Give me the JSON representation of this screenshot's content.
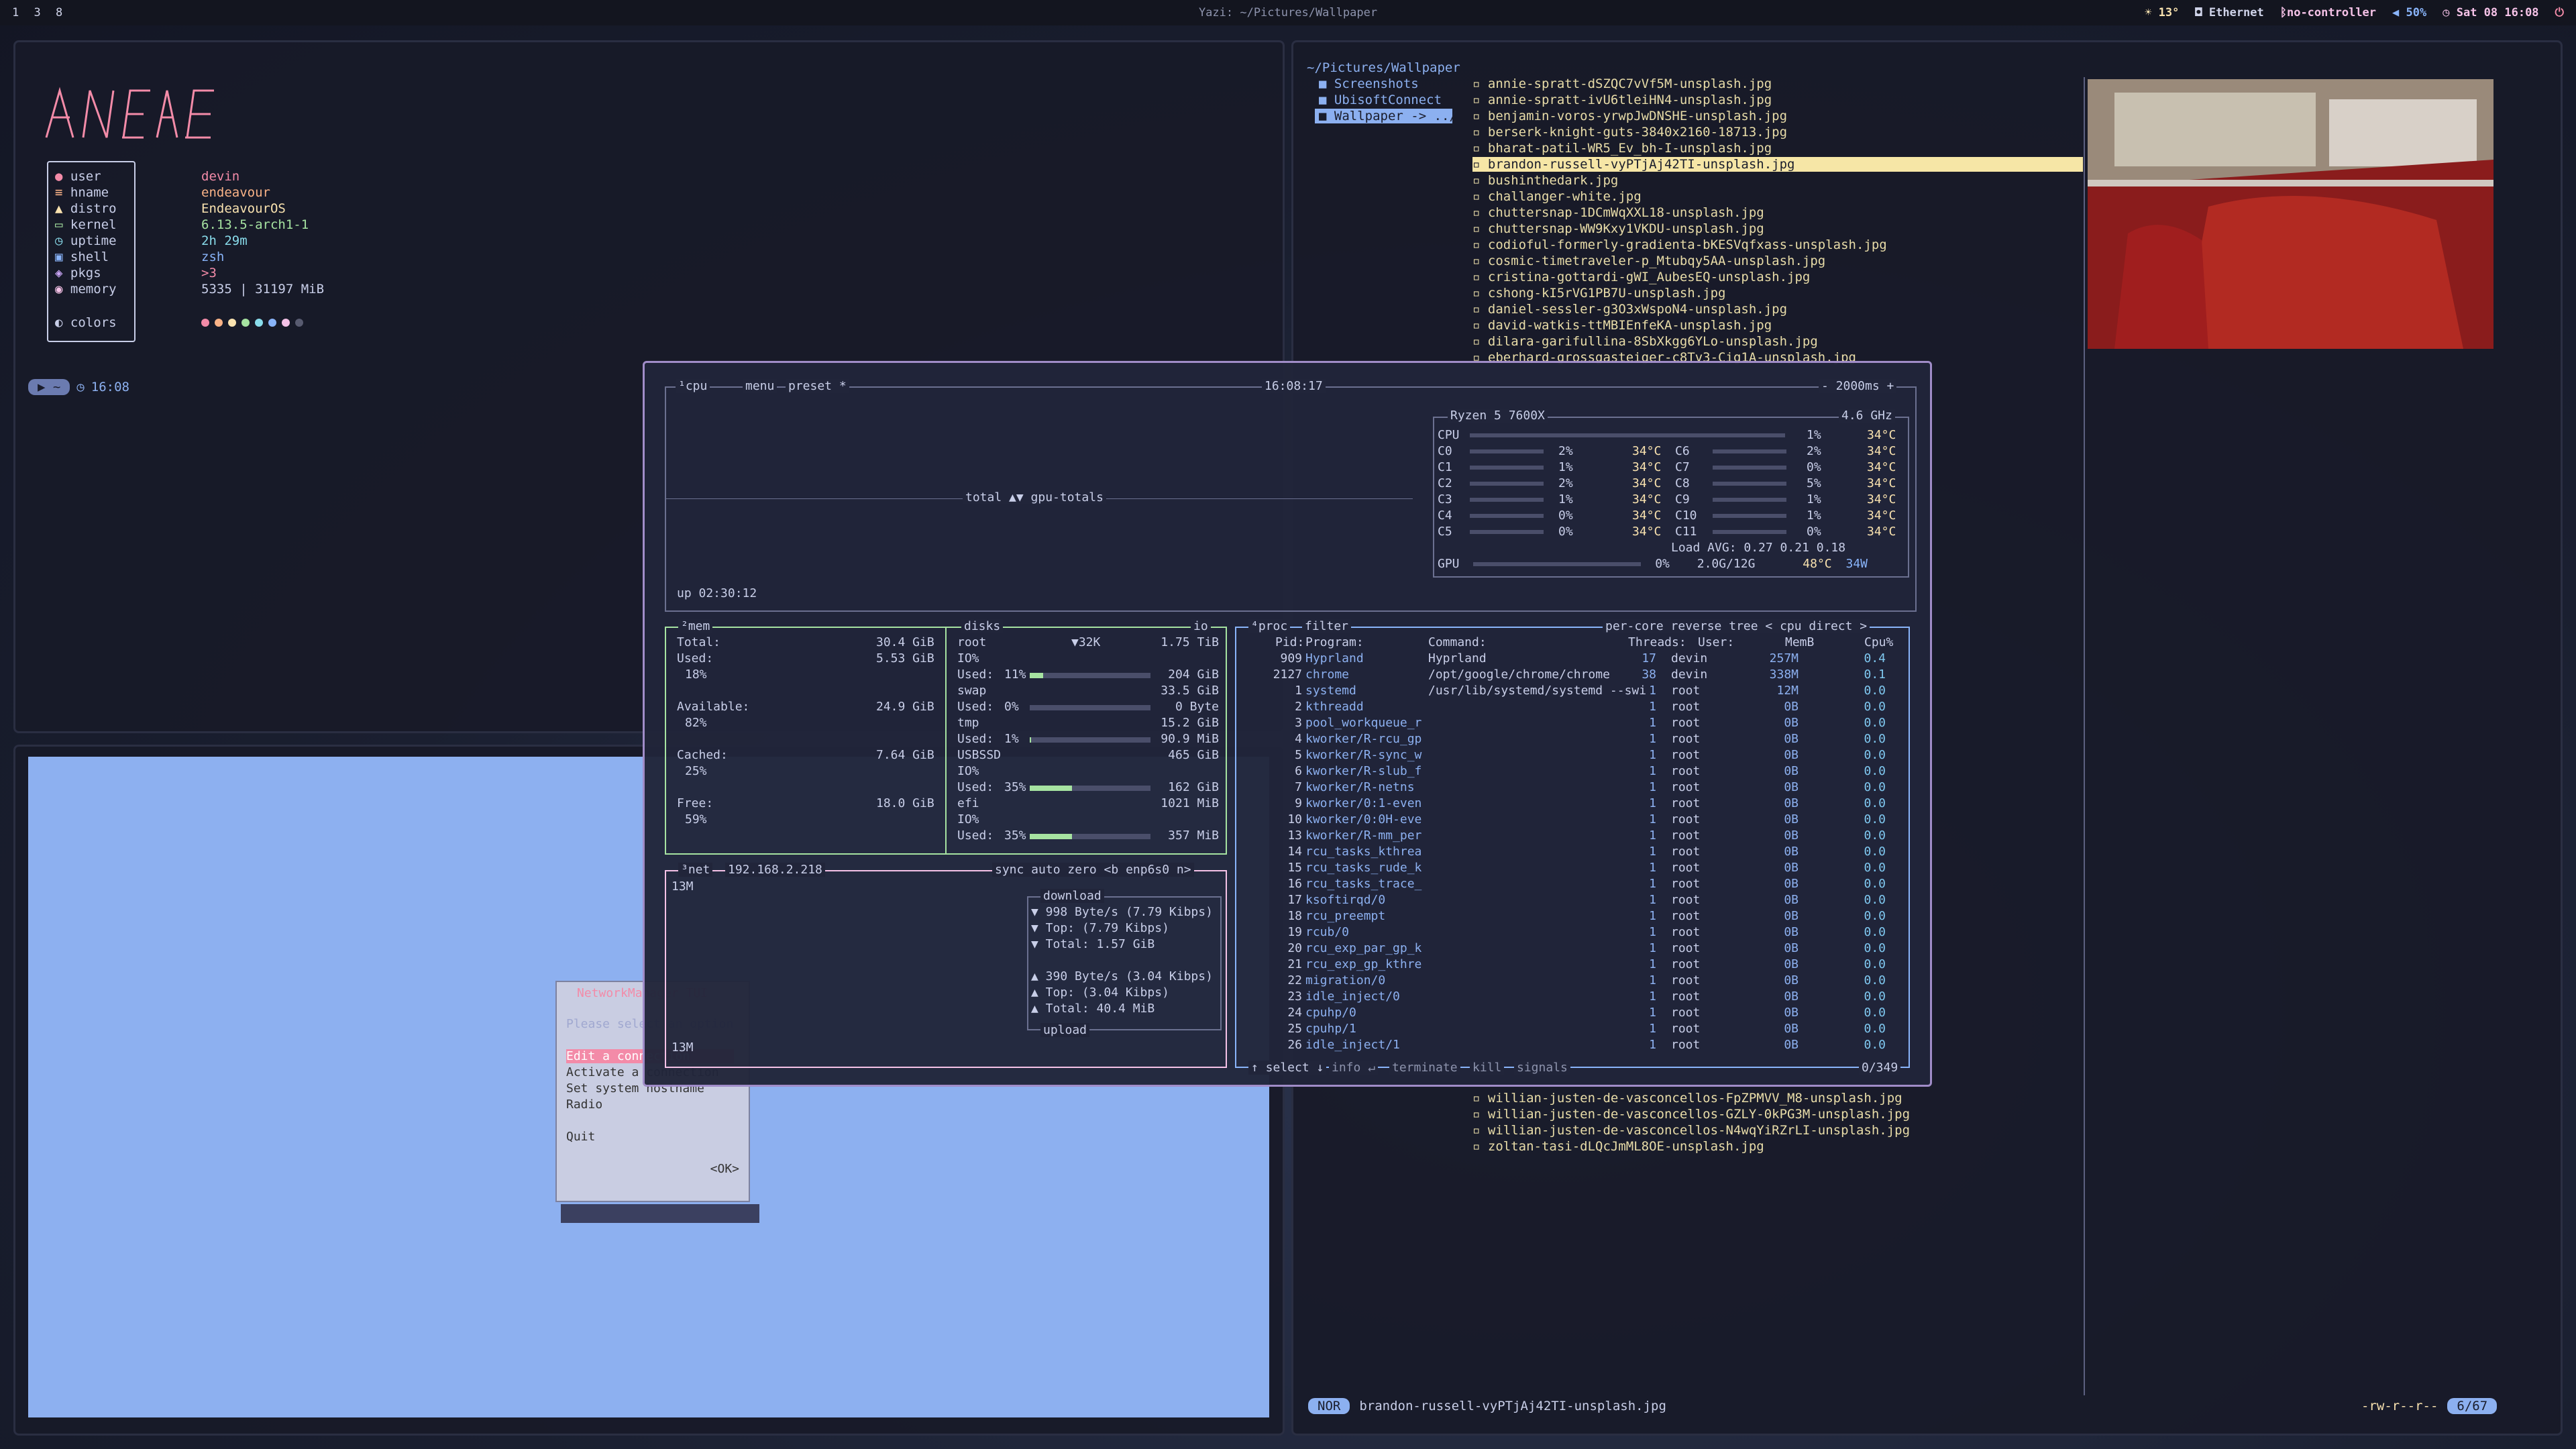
{
  "topbar": {
    "workspaces": [
      "1",
      "3",
      "8"
    ],
    "title": "Yazi: ~/Pictures/Wallpaper",
    "weather": "☀ 13°",
    "network": "Ethernet",
    "controller": "no-controller",
    "volume": "50%",
    "datetime": "Sat 08 16:08"
  },
  "fetch": {
    "rows": [
      {
        "key": "user",
        "val": "devin"
      },
      {
        "key": "hname",
        "val": "endeavour"
      },
      {
        "key": "distro",
        "val": "EndeavourOS"
      },
      {
        "key": "kernel",
        "val": "6.13.5-arch1-1"
      },
      {
        "key": "uptime",
        "val": "2h 29m"
      },
      {
        "key": "shell",
        "val": "zsh"
      },
      {
        "key": "pkgs",
        "val": ">3"
      },
      {
        "key": "memory",
        "val": "5335 | 31197 MiB"
      }
    ],
    "colors_label": "colors",
    "dot_colors": [
      "#f38ba8",
      "#fab387",
      "#f9e2af",
      "#a6e3a1",
      "#89dceb",
      "#89b4fa",
      "#f5c2e7",
      "#585b70"
    ]
  },
  "prompt": {
    "path": "~",
    "time": "16:08"
  },
  "nmtui": {
    "title": "NetworkManager TUI",
    "hint": "Please select an option",
    "items": [
      "Edit a connection",
      "Activate a connection",
      "Set system hostname",
      "Radio",
      "Quit"
    ],
    "ok": "<OK>"
  },
  "yazi": {
    "path": "~/Pictures/Wallpaper",
    "dirs": [
      "Screenshots",
      "UbisoftConnect",
      "Wallpaper -> ../"
    ],
    "files_top": [
      "annie-spratt-dSZQC7vVf5M-unsplash.jpg",
      "annie-spratt-ivU6tleiHN4-unsplash.jpg",
      "benjamin-voros-yrwpJwDNSHE-unsplash.jpg",
      "berserk-knight-guts-3840x2160-18713.jpg",
      "bharat-patil-WR5_Ev_bh-I-unsplash.jpg",
      "brandon-russell-vyPTjAj42TI-unsplash.jpg",
      "bushinthedark.jpg",
      "challanger-white.jpg",
      "chuttersnap-1DCmWqXXL18-unsplash.jpg",
      "chuttersnap-WW9Kxy1VKDU-unsplash.jpg",
      "codioful-formerly-gradienta-bKESVqfxass-unsplash.jpg",
      "cosmic-timetraveler-p_Mtubqy5AA-unsplash.jpg",
      "cristina-gottardi-gWI_AubesEQ-unsplash.jpg",
      "cshong-kI5rVG1PB7U-unsplash.jpg",
      "daniel-sessler-g3O3xWspoN4-unsplash.jpg",
      "david-watkis-ttMBIEnfeKA-unsplash.jpg",
      "dilara-garifullina-8SbXkgg6YLo-unsplash.jpg",
      "eberhard-grossgasteiger-c8Tv3-Cig1A-unsplash.jpg"
    ],
    "files_bottom": [
      "willian-justen-de-vasconcellos-FpZPMVV_M8-unsplash.jpg",
      "willian-justen-de-vasconcellos-GZLY-0kPG3M-unsplash.jpg",
      "willian-justen-de-vasconcellos-N4wqYiRZrLI-unsplash.jpg",
      "zoltan-tasi-dLQcJmML8OE-unsplash.jpg"
    ],
    "selected_index": 5,
    "status_mode": "NOR",
    "status_file": "brandon-russell-vyPTjAj42TI-unsplash.jpg",
    "status_perm": "-rw-r--r--",
    "status_pos": "6/67"
  },
  "btop": {
    "cpu_tab": "¹cpu",
    "menu": "menu",
    "preset": "preset *",
    "clock": "16:08:17",
    "interval": "- 2000ms +",
    "graph_label": "total ▲▼ gpu-totals",
    "uptime": "up 02:30:12",
    "cpu_model": "Ryzen 5 7600X",
    "cpu_freq": "4.6 GHz",
    "cpu_total": {
      "name": "CPU",
      "pct": "1%",
      "temp": "34°C"
    },
    "cores": [
      {
        "a": "C0",
        "ap": "2%",
        "at": "34°C",
        "b": "C6",
        "bp": "2%",
        "bt": "34°C"
      },
      {
        "a": "C1",
        "ap": "1%",
        "at": "34°C",
        "b": "C7",
        "bp": "0%",
        "bt": "34°C"
      },
      {
        "a": "C2",
        "ap": "2%",
        "at": "34°C",
        "b": "C8",
        "bp": "5%",
        "bt": "34°C"
      },
      {
        "a": "C3",
        "ap": "1%",
        "at": "34°C",
        "b": "C9",
        "bp": "1%",
        "bt": "34°C"
      },
      {
        "a": "C4",
        "ap": "0%",
        "at": "34°C",
        "b": "C10",
        "bp": "1%",
        "bt": "34°C"
      },
      {
        "a": "C5",
        "ap": "0%",
        "at": "34°C",
        "b": "C11",
        "bp": "0%",
        "bt": "34°C"
      }
    ],
    "load": "Load AVG:   0.27   0.21   0.18",
    "gpu": {
      "name": "GPU",
      "pct": "0%",
      "mem": "2.0G/12G",
      "temp": "48°C",
      "power": "34W"
    },
    "mem": {
      "title": "²mem",
      "total": {
        "k": "Total:",
        "v": "30.4 GiB"
      },
      "used": {
        "k": "Used:",
        "v": "5.53 GiB",
        "p": "18%"
      },
      "available": {
        "k": "Available:",
        "v": "24.9 GiB",
        "p": "82%"
      },
      "cached": {
        "k": "Cached:",
        "v": "7.64 GiB",
        "p": "25%"
      },
      "free": {
        "k": "Free:",
        "v": "18.0 GiB",
        "p": "59%"
      }
    },
    "disks": {
      "title": "disks",
      "io": "io",
      "rows": [
        {
          "name": "root",
          "mid": "▼32K",
          "size": "1.75 TiB"
        },
        {
          "name": "IO%",
          "mid": "",
          "size": ""
        },
        {
          "name": "Used:",
          "mid": "11%",
          "size": "204 GiB",
          "fill": 0.11
        },
        {
          "name": "swap",
          "mid": "",
          "size": "33.5 GiB"
        },
        {
          "name": "Used:",
          "mid": "0%",
          "size": "0 Byte",
          "fill": 0
        },
        {
          "name": "tmp",
          "mid": "",
          "size": "15.2 GiB"
        },
        {
          "name": "Used:",
          "mid": "1%",
          "size": "90.9 MiB",
          "fill": 0.01
        },
        {
          "name": "USBSSD",
          "mid": "",
          "size": "465 GiB"
        },
        {
          "name": "IO%",
          "mid": "",
          "size": ""
        },
        {
          "name": "Used:",
          "mid": "35%",
          "size": "162 GiB",
          "fill": 0.35
        },
        {
          "name": "efi",
          "mid": "",
          "size": "1021 MiB"
        },
        {
          "name": "IO%",
          "mid": "",
          "size": ""
        },
        {
          "name": "Used:",
          "mid": "35%",
          "size": "357 MiB",
          "fill": 0.35
        }
      ]
    },
    "net": {
      "title": "³net",
      "ip": "192.168.2.218",
      "opts": "sync auto zero <b enp6s0 n>",
      "scale_top": "13M",
      "scale_bot": "13M",
      "download": "download",
      "dl_rate": "▼ 998 Byte/s (7.79 Kibps)",
      "dl_top": "▼ Top:        (7.79 Kibps)",
      "dl_total": "▼ Total:        1.57 GiB",
      "ul_rate": "▲ 390 Byte/s (3.04 Kibps)",
      "ul_top": "▲ Top:        (3.04 Kibps)",
      "ul_total": "▲ Total:        40.4 MiB",
      "upload": "upload"
    },
    "proc": {
      "title": "⁴proc",
      "filter": "filter",
      "opts": "per-core reverse tree < cpu direct >",
      "headers": {
        "pid": "Pid:",
        "prog": "Program:",
        "cmd": "Command:",
        "thr": "Threads:",
        "user": "User:",
        "mem": "MemB",
        "cpu": "Cpu%"
      },
      "rows": [
        {
          "pid": "909",
          "prog": "Hyprland",
          "cmd": "Hyprland",
          "thr": "17",
          "user": "devin",
          "mem": "257M",
          "cpu": "0.4"
        },
        {
          "pid": "2127",
          "prog": "chrome",
          "cmd": "/opt/google/chrome/chrome",
          "thr": "38",
          "user": "devin",
          "mem": "338M",
          "cpu": "0.1"
        },
        {
          "pid": "1",
          "prog": "systemd",
          "cmd": "/usr/lib/systemd/systemd --swi",
          "thr": "1",
          "user": "root",
          "mem": "12M",
          "cpu": "0.0"
        },
        {
          "pid": "2",
          "prog": "kthreadd",
          "cmd": "",
          "thr": "1",
          "user": "root",
          "mem": "0B",
          "cpu": "0.0"
        },
        {
          "pid": "3",
          "prog": "pool_workqueue_r",
          "cmd": "",
          "thr": "1",
          "user": "root",
          "mem": "0B",
          "cpu": "0.0"
        },
        {
          "pid": "4",
          "prog": "kworker/R-rcu_gp",
          "cmd": "",
          "thr": "1",
          "user": "root",
          "mem": "0B",
          "cpu": "0.0"
        },
        {
          "pid": "5",
          "prog": "kworker/R-sync_w",
          "cmd": "",
          "thr": "1",
          "user": "root",
          "mem": "0B",
          "cpu": "0.0"
        },
        {
          "pid": "6",
          "prog": "kworker/R-slub_f",
          "cmd": "",
          "thr": "1",
          "user": "root",
          "mem": "0B",
          "cpu": "0.0"
        },
        {
          "pid": "7",
          "prog": "kworker/R-netns",
          "cmd": "",
          "thr": "1",
          "user": "root",
          "mem": "0B",
          "cpu": "0.0"
        },
        {
          "pid": "9",
          "prog": "kworker/0:1-even",
          "cmd": "",
          "thr": "1",
          "user": "root",
          "mem": "0B",
          "cpu": "0.0"
        },
        {
          "pid": "10",
          "prog": "kworker/0:0H-eve",
          "cmd": "",
          "thr": "1",
          "user": "root",
          "mem": "0B",
          "cpu": "0.0"
        },
        {
          "pid": "13",
          "prog": "kworker/R-mm_per",
          "cmd": "",
          "thr": "1",
          "user": "root",
          "mem": "0B",
          "cpu": "0.0"
        },
        {
          "pid": "14",
          "prog": "rcu_tasks_kthrea",
          "cmd": "",
          "thr": "1",
          "user": "root",
          "mem": "0B",
          "cpu": "0.0"
        },
        {
          "pid": "15",
          "prog": "rcu_tasks_rude_k",
          "cmd": "",
          "thr": "1",
          "user": "root",
          "mem": "0B",
          "cpu": "0.0"
        },
        {
          "pid": "16",
          "prog": "rcu_tasks_trace_",
          "cmd": "",
          "thr": "1",
          "user": "root",
          "mem": "0B",
          "cpu": "0.0"
        },
        {
          "pid": "17",
          "prog": "ksoftirqd/0",
          "cmd": "",
          "thr": "1",
          "user": "root",
          "mem": "0B",
          "cpu": "0.0"
        },
        {
          "pid": "18",
          "prog": "rcu_preempt",
          "cmd": "",
          "thr": "1",
          "user": "root",
          "mem": "0B",
          "cpu": "0.0"
        },
        {
          "pid": "19",
          "prog": "rcub/0",
          "cmd": "",
          "thr": "1",
          "user": "root",
          "mem": "0B",
          "cpu": "0.0"
        },
        {
          "pid": "20",
          "prog": "rcu_exp_par_gp_k",
          "cmd": "",
          "thr": "1",
          "user": "root",
          "mem": "0B",
          "cpu": "0.0"
        },
        {
          "pid": "21",
          "prog": "rcu_exp_gp_kthre",
          "cmd": "",
          "thr": "1",
          "user": "root",
          "mem": "0B",
          "cpu": "0.0"
        },
        {
          "pid": "22",
          "prog": "migration/0",
          "cmd": "",
          "thr": "1",
          "user": "root",
          "mem": "0B",
          "cpu": "0.0"
        },
        {
          "pid": "23",
          "prog": "idle_inject/0",
          "cmd": "",
          "thr": "1",
          "user": "root",
          "mem": "0B",
          "cpu": "0.0"
        },
        {
          "pid": "24",
          "prog": "cpuhp/0",
          "cmd": "",
          "thr": "1",
          "user": "root",
          "mem": "0B",
          "cpu": "0.0"
        },
        {
          "pid": "25",
          "prog": "cpuhp/1",
          "cmd": "",
          "thr": "1",
          "user": "root",
          "mem": "0B",
          "cpu": "0.0"
        },
        {
          "pid": "26",
          "prog": "idle_inject/1",
          "cmd": "",
          "thr": "1",
          "user": "root",
          "mem": "0B",
          "cpu": "0.0"
        }
      ],
      "footer": [
        "↑ select ↓",
        "info ↵",
        "terminate",
        "kill",
        "signals"
      ],
      "count": "0/349"
    }
  },
  "colors": {
    "accent": "#a08cc8",
    "selected": "#f6e6a6",
    "link": "#8cb0f0",
    "green": "#a6e3a1"
  }
}
